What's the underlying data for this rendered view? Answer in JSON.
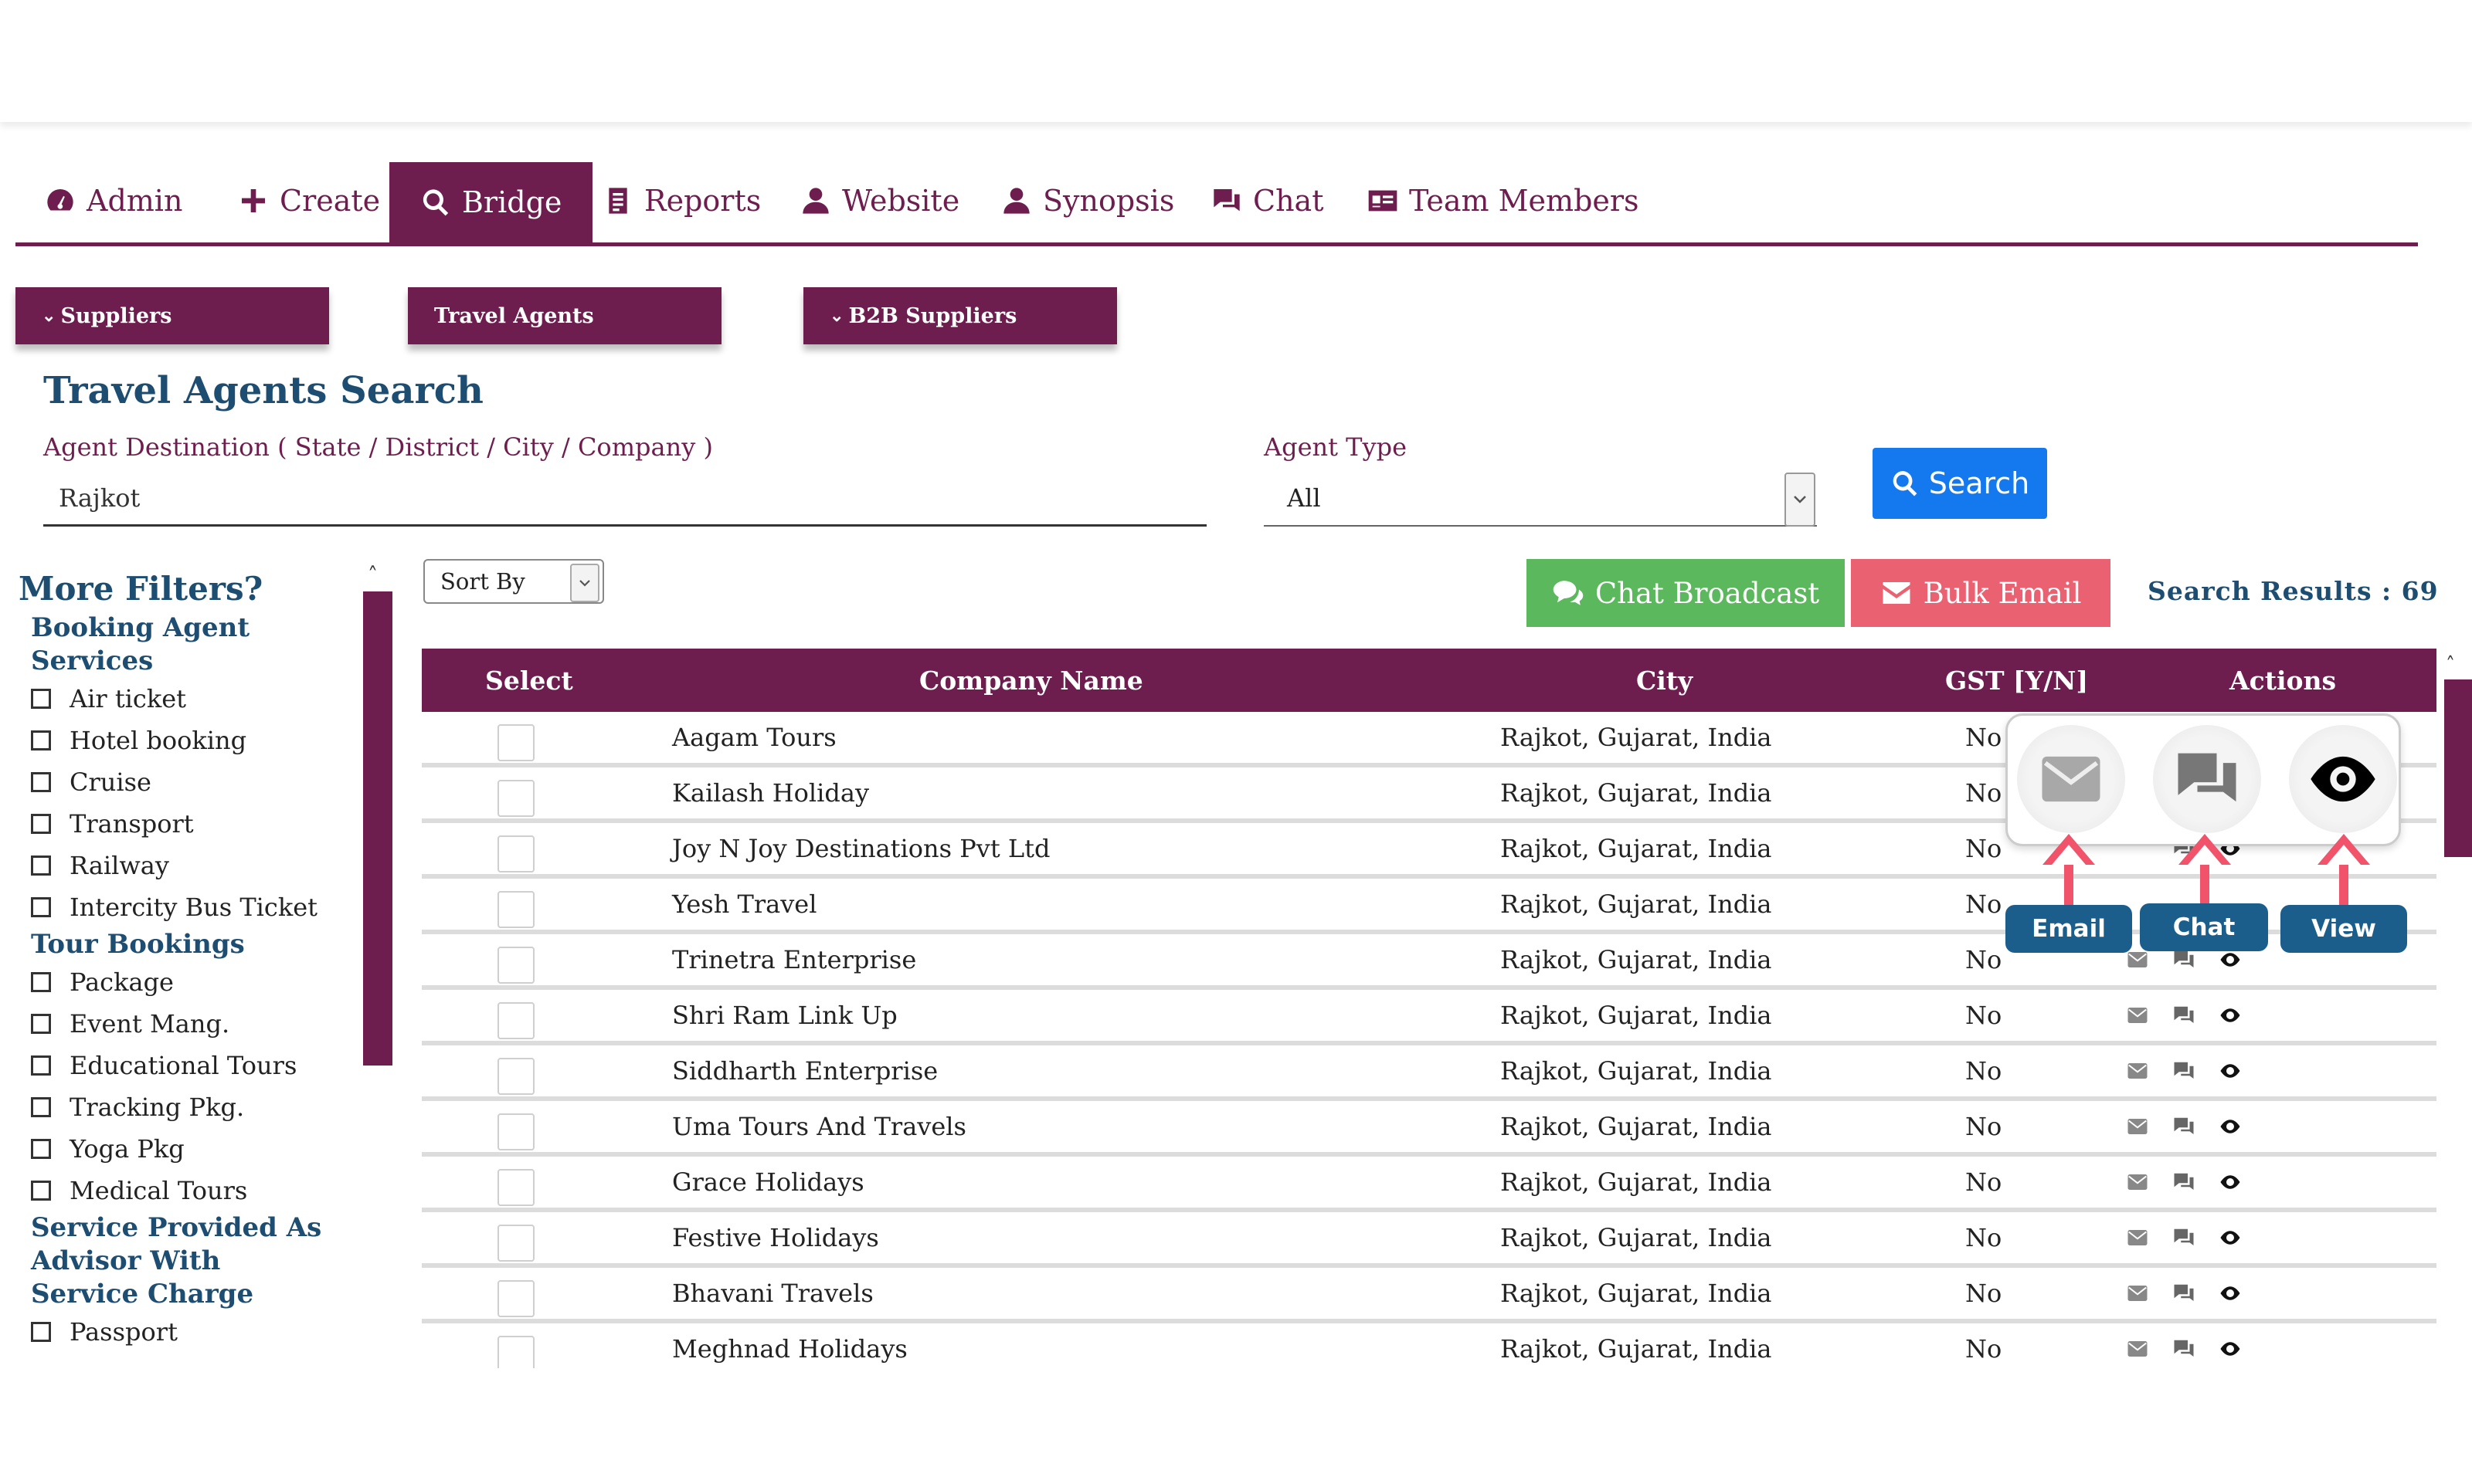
{
  "nav": {
    "tabs": [
      {
        "label": "Admin",
        "icon": "dashboard-icon"
      },
      {
        "label": "Create",
        "icon": "plus-icon"
      },
      {
        "label": "Bridge",
        "icon": "search-icon",
        "active": true
      },
      {
        "label": "Reports",
        "icon": "report-icon"
      },
      {
        "label": "Website",
        "icon": "user-icon"
      },
      {
        "label": "Synopsis",
        "icon": "user-icon"
      },
      {
        "label": "Chat",
        "icon": "chat-icon"
      },
      {
        "label": "Team Members",
        "icon": "id-card-icon"
      }
    ]
  },
  "categories": {
    "suppliers": "Suppliers",
    "travel_agents": "Travel Agents",
    "b2b_suppliers": "B2B Suppliers"
  },
  "search": {
    "title": "Travel Agents Search",
    "destination_label": "Agent Destination ( State / District / City / Company )",
    "destination_value": "Rajkot",
    "agent_type_label": "Agent Type",
    "agent_type_value": "All",
    "button_label": "Search"
  },
  "filters": {
    "title": "More Filters?",
    "groups": [
      {
        "title": "Booking Agent Services",
        "items": [
          "Air ticket",
          "Hotel booking",
          "Cruise",
          "Transport",
          "Railway",
          "Intercity Bus Ticket"
        ]
      },
      {
        "title": "Tour Bookings",
        "items": [
          "Package",
          "Event Mang.",
          "Educational Tours",
          "Tracking Pkg.",
          "Yoga Pkg",
          "Medical Tours"
        ]
      },
      {
        "title": "Service Provided As Advisor With Service Charge",
        "items": [
          "Passport"
        ]
      }
    ]
  },
  "toolbar": {
    "sort_by": "Sort By",
    "chat_broadcast": "Chat Broadcast",
    "bulk_email": "Bulk Email",
    "results": "Search Results : 69"
  },
  "table": {
    "headers": [
      "Select",
      "Company Name",
      "City",
      "GST [Y/N]",
      "Actions"
    ],
    "rows": [
      {
        "company": "Aagam Tours",
        "city": "Rajkot, Gujarat, India",
        "gst": "No"
      },
      {
        "company": "Kailash Holiday",
        "city": "Rajkot, Gujarat, India",
        "gst": "No"
      },
      {
        "company": "Joy N Joy Destinations Pvt Ltd",
        "city": "Rajkot, Gujarat, India",
        "gst": "No"
      },
      {
        "company": "Yesh Travel",
        "city": "Rajkot, Gujarat, India",
        "gst": "No"
      },
      {
        "company": "Trinetra Enterprise",
        "city": "Rajkot, Gujarat, India",
        "gst": "No"
      },
      {
        "company": "Shri Ram Link Up",
        "city": "Rajkot, Gujarat, India",
        "gst": "No"
      },
      {
        "company": "Siddharth Enterprise",
        "city": "Rajkot, Gujarat, India",
        "gst": "No"
      },
      {
        "company": "Uma Tours And Travels",
        "city": "Rajkot, Gujarat, India",
        "gst": "No"
      },
      {
        "company": "Grace Holidays",
        "city": "Rajkot, Gujarat, India",
        "gst": "No"
      },
      {
        "company": "Festive Holidays",
        "city": "Rajkot, Gujarat, India",
        "gst": "No"
      },
      {
        "company": "Bhavani Travels",
        "city": "Rajkot, Gujarat, India",
        "gst": "No"
      },
      {
        "company": "Meghnad Holidays",
        "city": "Rajkot, Gujarat, India",
        "gst": "No"
      }
    ]
  },
  "callout": {
    "email": "Email",
    "chat": "Chat",
    "view": "View"
  },
  "colors": {
    "brand": "#6e1e4e",
    "heading": "#1d4e72",
    "search_button": "#1479ef",
    "chat_broadcast": "#5cb85c",
    "bulk_email": "#ea6272",
    "arrow": "#f0536a",
    "pill": "#1b5e8c"
  }
}
